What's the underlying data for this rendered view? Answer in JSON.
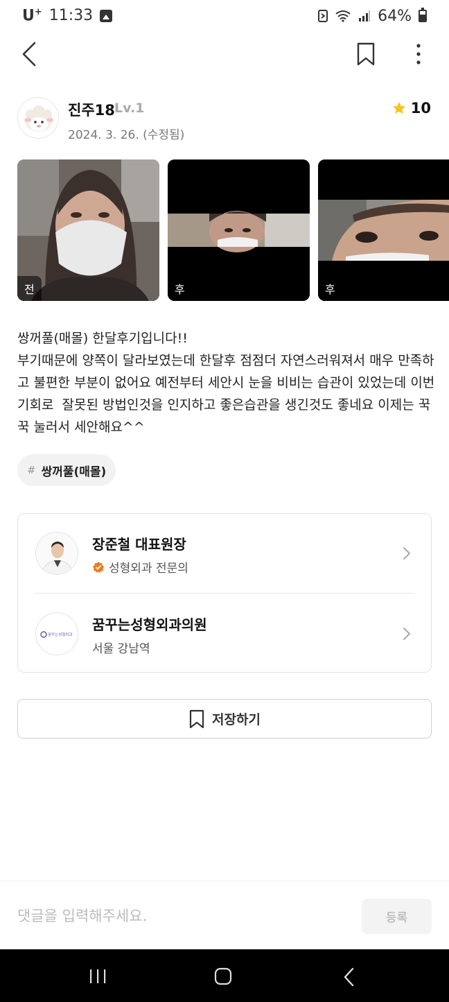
{
  "status_bar": {
    "carrier": "U",
    "carrier_sup": "+",
    "time": "11:33",
    "battery": "64%"
  },
  "author": {
    "name": "진주18",
    "level": "Lv.1",
    "date": "2024. 3. 26. (수정됨)",
    "rating": "10"
  },
  "photos": [
    {
      "badge": "전"
    },
    {
      "badge": "후"
    },
    {
      "badge": "후"
    }
  ],
  "post": {
    "body": "쌍꺼풀(매몰) 한달후기입니다!!\n부기때문에 양쪽이 달라보였는데 한달후 점점더 자연스러워져서 매우 만족하고 불편한 부분이 없어요 예전부터 세안시 눈을 비비는 습관이 있었는데 이번기회로  잘못된 방법인것을 인지하고 좋은습관을 생긴것도 좋네요 이제는 꾹꾹 눌러서 세안해요^^"
  },
  "tag": {
    "hash": "#",
    "label": "쌍꺼풀(매몰)"
  },
  "doctor": {
    "name": "장준철 대표원장",
    "specialty": "성형외과 전문의"
  },
  "clinic": {
    "name": "꿈꾸는성형외과의원",
    "location": "서울 강남역",
    "logo_text": "꿈꾸는성형외과"
  },
  "save_label": "저장하기",
  "comment": {
    "placeholder": "댓글을 입력해주세요.",
    "submit_label": "등록"
  },
  "colors": {
    "star": "#f5c518",
    "verified": "#f07b1f",
    "nav_bg": "#000000"
  }
}
